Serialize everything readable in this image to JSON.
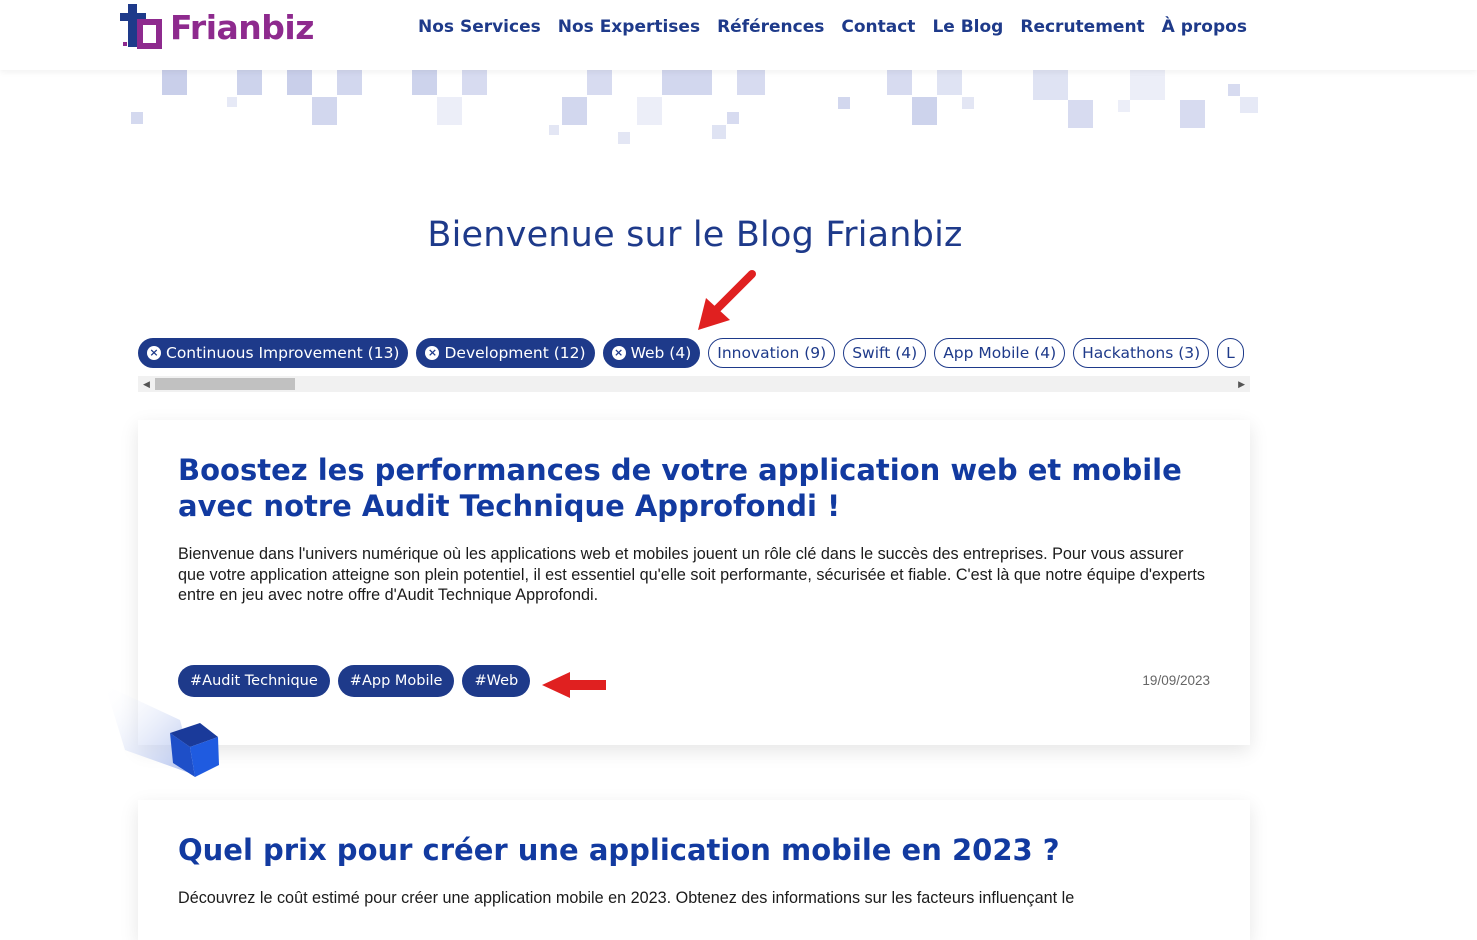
{
  "header": {
    "logo_text": "Frianbiz",
    "nav": [
      "Nos Services",
      "Nos Expertises",
      "Références",
      "Contact",
      "Le Blog",
      "Recrutement",
      "À propos"
    ]
  },
  "page_title": "Bienvenue sur le Blog Frianbiz",
  "filters": [
    {
      "label": "Continuous Improvement (13)",
      "active": true
    },
    {
      "label": "Development (12)",
      "active": true
    },
    {
      "label": "Web (4)",
      "active": true
    },
    {
      "label": "Innovation (9)",
      "active": false
    },
    {
      "label": "Swift (4)",
      "active": false
    },
    {
      "label": "App Mobile (4)",
      "active": false
    },
    {
      "label": "Hackathons (3)",
      "active": false
    },
    {
      "label": "L",
      "active": false
    }
  ],
  "posts": [
    {
      "title": "Boostez les performances de votre application web et mobile avec notre Audit Technique Approfondi !",
      "excerpt": "Bienvenue dans l'univers numérique où les applications web et mobiles jouent un rôle clé dans le succès des entreprises. Pour vous assurer que votre application atteigne son plein potentiel, il est essentiel qu'elle soit performante, sécurisée et fiable. C'est là que notre équipe d'experts entre en jeu avec notre offre d'Audit Technique Approfondi.",
      "tags": [
        "#Audit Technique",
        "#App Mobile",
        "#Web"
      ],
      "date": "19/09/2023"
    },
    {
      "title": "Quel prix pour créer une application mobile en 2023 ?",
      "excerpt": "Découvrez le coût estimé pour créer une application mobile en 2023. Obtenez des informations sur les facteurs influençant le"
    }
  ],
  "colors": {
    "brand_blue": "#1e3a8a",
    "brand_purple": "#8e2a8e",
    "title_blue": "#123aa0",
    "annotation_red": "#e02020"
  },
  "icons": [
    "logo-icon",
    "close-icon",
    "arrow-annotation",
    "cube-decoration"
  ]
}
